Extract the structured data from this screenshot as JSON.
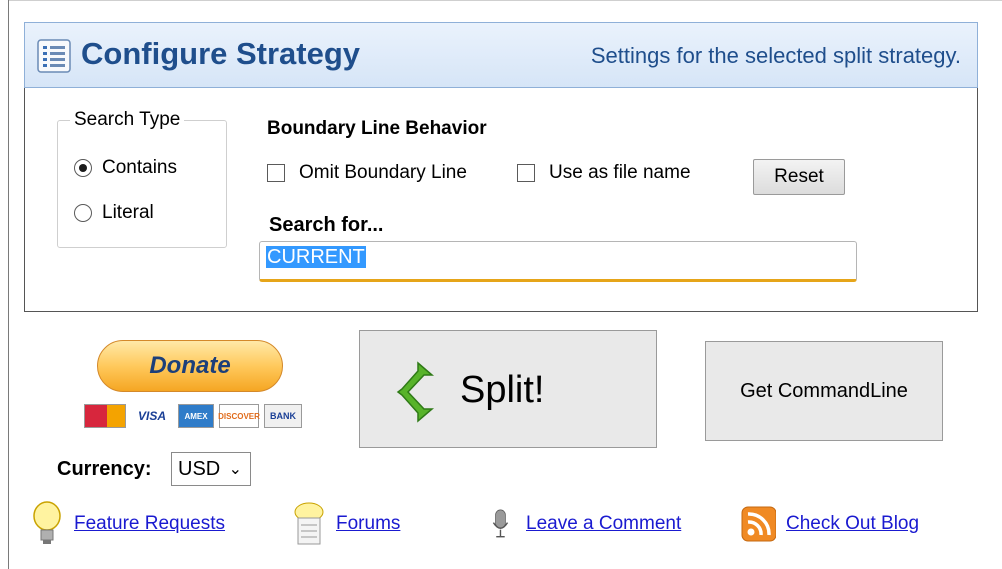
{
  "header": {
    "title": "Configure Strategy",
    "subtitle": "Settings for the selected split strategy.",
    "icon": "list-icon"
  },
  "search_type": {
    "legend": "Search Type",
    "options": [
      {
        "label": "Contains",
        "checked": true
      },
      {
        "label": "Literal",
        "checked": false
      }
    ]
  },
  "boundary": {
    "heading": "Boundary Line Behavior",
    "omit_label": "Omit Boundary Line",
    "omit_checked": false,
    "filename_label": "Use as file name",
    "filename_checked": false,
    "reset_label": "Reset"
  },
  "search": {
    "label": "Search for...",
    "value": "CURRENT"
  },
  "donate": {
    "button_label": "Donate",
    "cards": [
      "MasterCard",
      "VISA",
      "AMEX",
      "DISCOVER",
      "BANK"
    ],
    "currency_label": "Currency:",
    "currency_value": "USD"
  },
  "actions": {
    "split_label": "Split!",
    "commandline_label": "Get CommandLine"
  },
  "footer": {
    "links": [
      {
        "label": "Feature Requests",
        "icon": "lightbulb-icon"
      },
      {
        "label": "Forums",
        "icon": "forum-icon"
      },
      {
        "label": "Leave a Comment",
        "icon": "microphone-icon"
      },
      {
        "label": "Check Out Blog",
        "icon": "rss-icon"
      }
    ]
  },
  "colors": {
    "header_text": "#1f4e8c",
    "link": "#1a1ad0",
    "selection": "#3399ff",
    "input_focus": "#e6a519",
    "split_arrow": "#58b32a"
  }
}
